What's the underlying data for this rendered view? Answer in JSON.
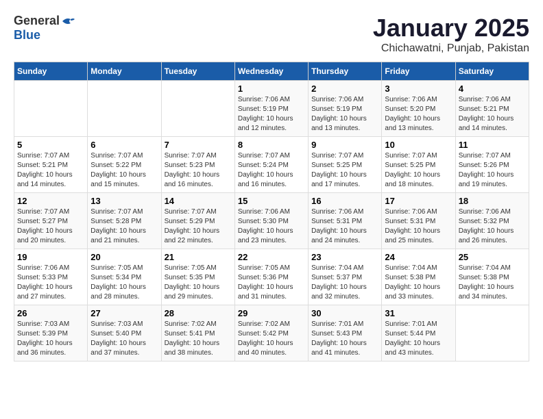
{
  "logo": {
    "general": "General",
    "blue": "Blue"
  },
  "title": "January 2025",
  "subtitle": "Chichawatni, Punjab, Pakistan",
  "headers": [
    "Sunday",
    "Monday",
    "Tuesday",
    "Wednesday",
    "Thursday",
    "Friday",
    "Saturday"
  ],
  "weeks": [
    [
      {
        "day": "",
        "info": ""
      },
      {
        "day": "",
        "info": ""
      },
      {
        "day": "",
        "info": ""
      },
      {
        "day": "1",
        "info": "Sunrise: 7:06 AM\nSunset: 5:19 PM\nDaylight: 10 hours\nand 12 minutes."
      },
      {
        "day": "2",
        "info": "Sunrise: 7:06 AM\nSunset: 5:19 PM\nDaylight: 10 hours\nand 13 minutes."
      },
      {
        "day": "3",
        "info": "Sunrise: 7:06 AM\nSunset: 5:20 PM\nDaylight: 10 hours\nand 13 minutes."
      },
      {
        "day": "4",
        "info": "Sunrise: 7:06 AM\nSunset: 5:21 PM\nDaylight: 10 hours\nand 14 minutes."
      }
    ],
    [
      {
        "day": "5",
        "info": "Sunrise: 7:07 AM\nSunset: 5:21 PM\nDaylight: 10 hours\nand 14 minutes."
      },
      {
        "day": "6",
        "info": "Sunrise: 7:07 AM\nSunset: 5:22 PM\nDaylight: 10 hours\nand 15 minutes."
      },
      {
        "day": "7",
        "info": "Sunrise: 7:07 AM\nSunset: 5:23 PM\nDaylight: 10 hours\nand 16 minutes."
      },
      {
        "day": "8",
        "info": "Sunrise: 7:07 AM\nSunset: 5:24 PM\nDaylight: 10 hours\nand 16 minutes."
      },
      {
        "day": "9",
        "info": "Sunrise: 7:07 AM\nSunset: 5:25 PM\nDaylight: 10 hours\nand 17 minutes."
      },
      {
        "day": "10",
        "info": "Sunrise: 7:07 AM\nSunset: 5:25 PM\nDaylight: 10 hours\nand 18 minutes."
      },
      {
        "day": "11",
        "info": "Sunrise: 7:07 AM\nSunset: 5:26 PM\nDaylight: 10 hours\nand 19 minutes."
      }
    ],
    [
      {
        "day": "12",
        "info": "Sunrise: 7:07 AM\nSunset: 5:27 PM\nDaylight: 10 hours\nand 20 minutes."
      },
      {
        "day": "13",
        "info": "Sunrise: 7:07 AM\nSunset: 5:28 PM\nDaylight: 10 hours\nand 21 minutes."
      },
      {
        "day": "14",
        "info": "Sunrise: 7:07 AM\nSunset: 5:29 PM\nDaylight: 10 hours\nand 22 minutes."
      },
      {
        "day": "15",
        "info": "Sunrise: 7:06 AM\nSunset: 5:30 PM\nDaylight: 10 hours\nand 23 minutes."
      },
      {
        "day": "16",
        "info": "Sunrise: 7:06 AM\nSunset: 5:31 PM\nDaylight: 10 hours\nand 24 minutes."
      },
      {
        "day": "17",
        "info": "Sunrise: 7:06 AM\nSunset: 5:31 PM\nDaylight: 10 hours\nand 25 minutes."
      },
      {
        "day": "18",
        "info": "Sunrise: 7:06 AM\nSunset: 5:32 PM\nDaylight: 10 hours\nand 26 minutes."
      }
    ],
    [
      {
        "day": "19",
        "info": "Sunrise: 7:06 AM\nSunset: 5:33 PM\nDaylight: 10 hours\nand 27 minutes."
      },
      {
        "day": "20",
        "info": "Sunrise: 7:05 AM\nSunset: 5:34 PM\nDaylight: 10 hours\nand 28 minutes."
      },
      {
        "day": "21",
        "info": "Sunrise: 7:05 AM\nSunset: 5:35 PM\nDaylight: 10 hours\nand 29 minutes."
      },
      {
        "day": "22",
        "info": "Sunrise: 7:05 AM\nSunset: 5:36 PM\nDaylight: 10 hours\nand 31 minutes."
      },
      {
        "day": "23",
        "info": "Sunrise: 7:04 AM\nSunset: 5:37 PM\nDaylight: 10 hours\nand 32 minutes."
      },
      {
        "day": "24",
        "info": "Sunrise: 7:04 AM\nSunset: 5:38 PM\nDaylight: 10 hours\nand 33 minutes."
      },
      {
        "day": "25",
        "info": "Sunrise: 7:04 AM\nSunset: 5:38 PM\nDaylight: 10 hours\nand 34 minutes."
      }
    ],
    [
      {
        "day": "26",
        "info": "Sunrise: 7:03 AM\nSunset: 5:39 PM\nDaylight: 10 hours\nand 36 minutes."
      },
      {
        "day": "27",
        "info": "Sunrise: 7:03 AM\nSunset: 5:40 PM\nDaylight: 10 hours\nand 37 minutes."
      },
      {
        "day": "28",
        "info": "Sunrise: 7:02 AM\nSunset: 5:41 PM\nDaylight: 10 hours\nand 38 minutes."
      },
      {
        "day": "29",
        "info": "Sunrise: 7:02 AM\nSunset: 5:42 PM\nDaylight: 10 hours\nand 40 minutes."
      },
      {
        "day": "30",
        "info": "Sunrise: 7:01 AM\nSunset: 5:43 PM\nDaylight: 10 hours\nand 41 minutes."
      },
      {
        "day": "31",
        "info": "Sunrise: 7:01 AM\nSunset: 5:44 PM\nDaylight: 10 hours\nand 43 minutes."
      },
      {
        "day": "",
        "info": ""
      }
    ]
  ]
}
